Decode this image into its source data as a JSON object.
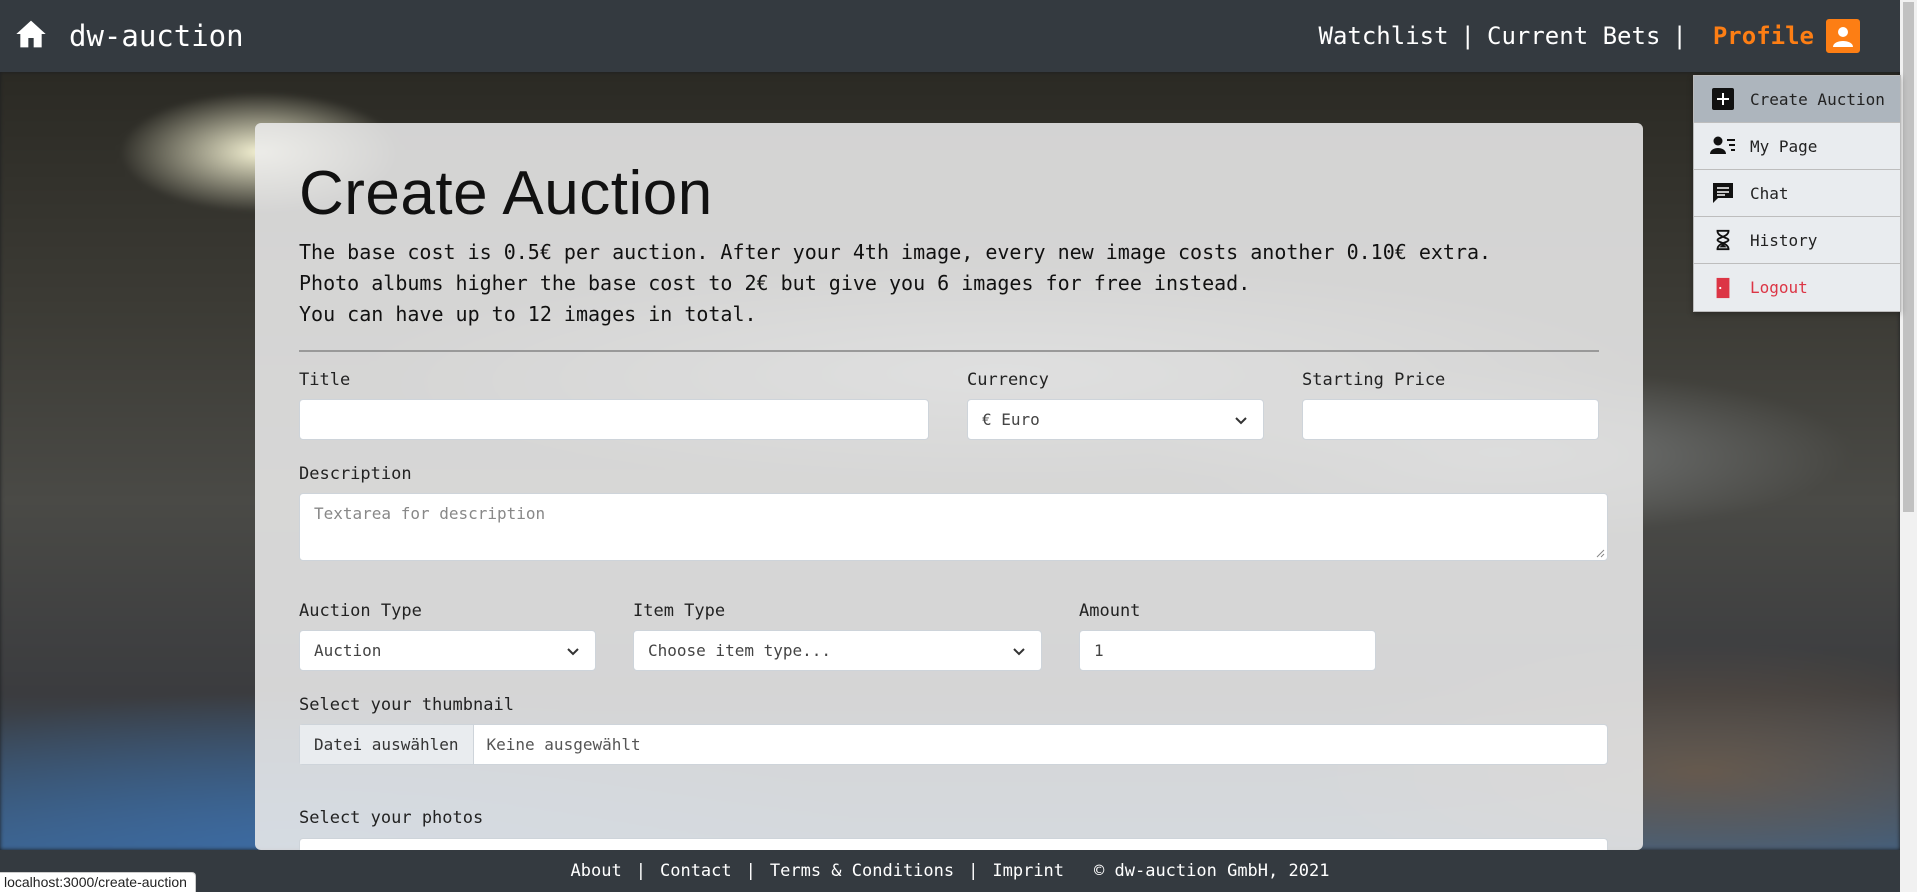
{
  "nav": {
    "brand": "dw-auction",
    "links": [
      "Watchlist",
      "Current Bets"
    ],
    "profile": "Profile"
  },
  "dropdown": {
    "items": [
      {
        "label": "Create Auction",
        "icon": "plus-icon"
      },
      {
        "label": "My Page",
        "icon": "user-list-icon"
      },
      {
        "label": "Chat",
        "icon": "chat-icon"
      },
      {
        "label": "History",
        "icon": "hourglass-icon"
      },
      {
        "label": "Logout",
        "icon": "door-icon"
      }
    ]
  },
  "form": {
    "title": "Create Auction",
    "info": [
      "The base cost is 0.5€ per auction. After your 4th image, every new image costs another 0.10€ extra.",
      "Photo albums higher the base cost to 2€ but give you 6 images for free instead.",
      "You can have up to 12 images in total."
    ],
    "title_label": "Title",
    "currency_label": "Currency",
    "currency_value": "€ Euro",
    "starting_price_label": "Starting Price",
    "description_label": "Description",
    "description_placeholder": "Textarea for description",
    "auction_type_label": "Auction Type",
    "auction_type_value": "Auction",
    "item_type_label": "Item Type",
    "item_type_value": "Choose item type...",
    "amount_label": "Amount",
    "amount_value": "1",
    "thumbnail_label": "Select your thumbnail",
    "file_button": "Datei auswählen",
    "file_none": "Keine ausgewählt",
    "photos_label": "Select your photos"
  },
  "footer": {
    "links": [
      "About",
      "Contact",
      "Terms & Conditions",
      "Imprint"
    ],
    "copyright": "© dw-auction GmbH, 2021"
  },
  "status_url": "localhost:3000/create-auction",
  "colors": {
    "navbar": "#343a40",
    "accent": "#fd7e14",
    "logout": "#dc3545"
  }
}
